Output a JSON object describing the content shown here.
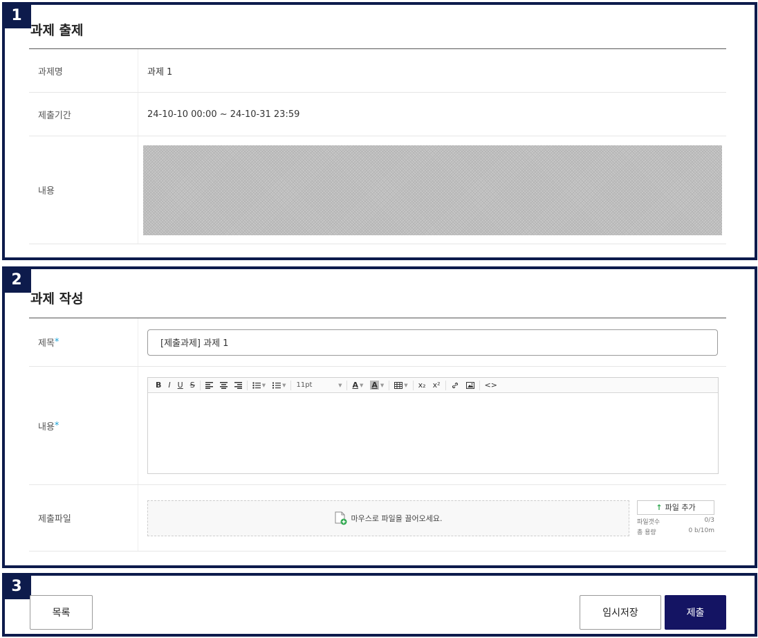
{
  "sections": {
    "s1_number": "1",
    "s2_number": "2",
    "s3_number": "3"
  },
  "assignment": {
    "title": "과제 출제",
    "name_label": "과제명",
    "name_value": "과제 1",
    "period_label": "제출기간",
    "period_value": "24-10-10 00:00 ~ 24-10-31 23:59",
    "content_label": "내용"
  },
  "write": {
    "title": "과제 작성",
    "subject_label": "제목",
    "required_mark": "*",
    "subject_value": "[제출과제] 과제 1",
    "content_label": "내용",
    "file_label": "제출파일"
  },
  "toolbar": {
    "bold": "B",
    "italic": "I",
    "underline": "U",
    "strike": "S",
    "font_size": "11pt",
    "font_color": "A",
    "bg_color": "A",
    "subscript": "x₂",
    "superscript": "x²",
    "code": "<>"
  },
  "upload": {
    "drop_text": "마우스로 파일을 끌어오세요.",
    "add_button": "파일 추가",
    "count_label": "파일갯수",
    "count_value": "0/3",
    "size_label": "총 용량",
    "size_value": "0 b/10m"
  },
  "actions": {
    "list": "목록",
    "temp_save": "임시저장",
    "submit": "제출"
  },
  "colors": {
    "frame": "#0d1b4c",
    "submit_bg": "#141463",
    "required": "#1aa0d6",
    "upload_icon": "#2fa84f"
  }
}
